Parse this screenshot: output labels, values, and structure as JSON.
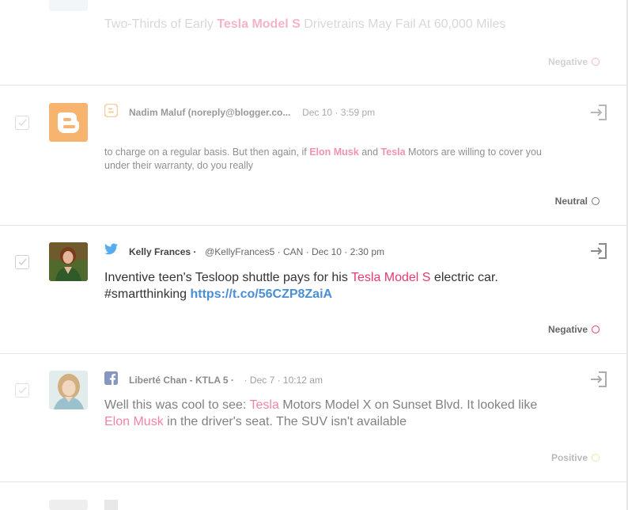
{
  "posts": [
    {
      "kind": "top-faded",
      "body": {
        "prefix": "Two-Thirds of Early ",
        "highlight": "Tesla Model S",
        "suffix": " Drivetrains May Fail At 60,000 Miles"
      },
      "sentiment": {
        "label": "Negative",
        "color": "#e8396e"
      }
    },
    {
      "kind": "blogger",
      "source_icon": "blogger-icon",
      "avatar_icon": "blogger-logo-icon",
      "author": "Nadim Maluf (noreply@blogger.co...",
      "timestamp": "Dec 10 · 3:59 pm",
      "body": {
        "p1": "to charge on a regular basis. But then again, if ",
        "h1": "Elon Musk",
        "p2": " and ",
        "h2": "Tesla",
        "p3": " Motors are willing to cover you under their warranty, do you really"
      },
      "sentiment": {
        "label": "Neutral",
        "color": "#777777"
      }
    },
    {
      "kind": "twitter",
      "source_icon": "twitter-bird-icon",
      "author": "Kelly Frances ·",
      "handle": "@KellyFrances5 · CAN · Dec 10 · 2:30 pm",
      "body": {
        "p1": "Inventive teen's Tesloop shuttle pays for his ",
        "h1": "Tesla Model S",
        "p2": " electric car. #smartthinking ",
        "link": "https://t.co/56CZP8ZaiA"
      },
      "sentiment": {
        "label": "Negative",
        "color": "#e8396e"
      }
    },
    {
      "kind": "facebook",
      "source_icon": "facebook-icon",
      "author": "Liberté Chan - KTLA 5 ·",
      "timestamp": "· Dec 7 · 10:12 am",
      "body": {
        "p1": "Well this was cool to see: ",
        "h1": "Tesla",
        "p2": " Motors Model X on Sunset Blvd. It looked like ",
        "h2": "Elon Musk",
        "p3": " in the driver's seat. The SUV isn't available"
      },
      "sentiment": {
        "label": "Positive",
        "color": "#e8c23a"
      }
    }
  ],
  "colors": {
    "highlight": "#e8396e",
    "link": "#4a8fd6",
    "twitter": "#55acee",
    "facebook": "#3b5998",
    "blogger": "#f4a24a"
  }
}
